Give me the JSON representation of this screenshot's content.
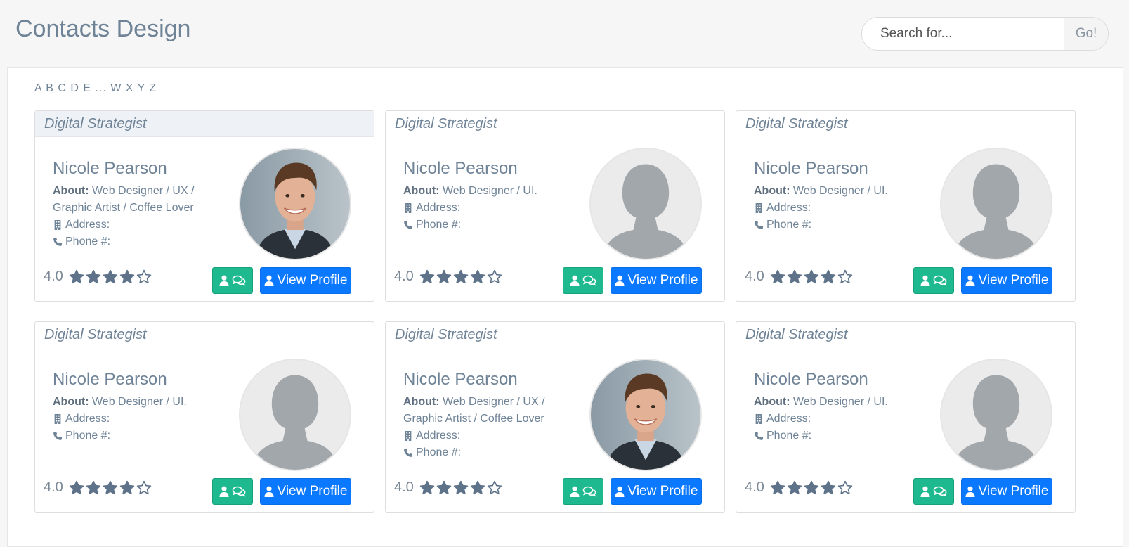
{
  "header": {
    "title": "Contacts Design",
    "search_placeholder": "Search for...",
    "search_button": "Go!"
  },
  "alphabet": "A B C D E ... W X Y Z",
  "cards": [
    {
      "role": "Digital Strategist",
      "name": "Nicole Pearson",
      "about_label": "About:",
      "about": "Web Designer / UX / Graphic Artist / Coffee Lover",
      "address_label": "Address:",
      "phone_label": "Phone #:",
      "rating": "4.0",
      "stars": 4,
      "photo": "man-photo",
      "view_label": "View Profile"
    },
    {
      "role": "Digital Strategist",
      "name": "Nicole Pearson",
      "about_label": "About:",
      "about": "Web Designer / UI.",
      "address_label": "Address:",
      "phone_label": "Phone #:",
      "rating": "4.0",
      "stars": 4,
      "photo": "placeholder",
      "view_label": "View Profile"
    },
    {
      "role": "Digital Strategist",
      "name": "Nicole Pearson",
      "about_label": "About:",
      "about": "Web Designer / UI.",
      "address_label": "Address:",
      "phone_label": "Phone #:",
      "rating": "4.0",
      "stars": 4,
      "photo": "placeholder",
      "view_label": "View Profile"
    },
    {
      "role": "Digital Strategist",
      "name": "Nicole Pearson",
      "about_label": "About:",
      "about": "Web Designer / UI.",
      "address_label": "Address:",
      "phone_label": "Phone #:",
      "rating": "4.0",
      "stars": 4,
      "photo": "placeholder",
      "view_label": "View Profile"
    },
    {
      "role": "Digital Strategist",
      "name": "Nicole Pearson",
      "about_label": "About:",
      "about": "Web Designer / UX / Graphic Artist / Coffee Lover",
      "address_label": "Address:",
      "phone_label": "Phone #:",
      "rating": "4.0",
      "stars": 4,
      "photo": "man-photo",
      "view_label": "View Profile"
    },
    {
      "role": "Digital Strategist",
      "name": "Nicole Pearson",
      "about_label": "About:",
      "about": "Web Designer / UI.",
      "address_label": "Address:",
      "phone_label": "Phone #:",
      "rating": "4.0",
      "stars": 4,
      "photo": "placeholder",
      "view_label": "View Profile"
    }
  ],
  "colors": {
    "accent_blue": "#0a78ff",
    "accent_green": "#1fb98f",
    "star": "#5e738a",
    "title": "#6f8397"
  }
}
